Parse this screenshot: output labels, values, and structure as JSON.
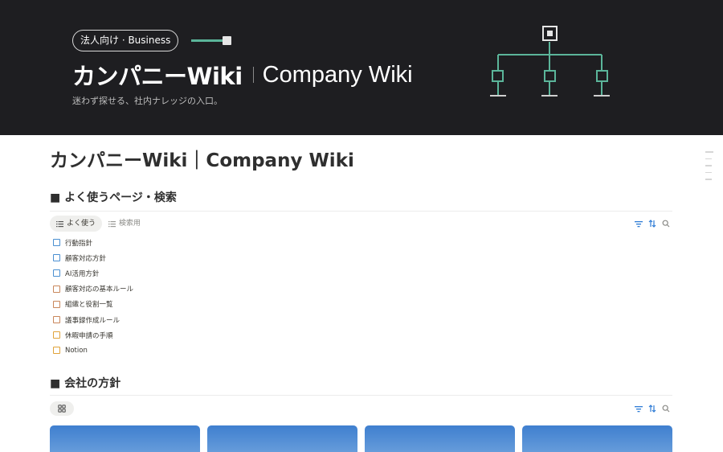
{
  "banner": {
    "badge": "法人向け · Business",
    "title_jp": "カンパニーWiki",
    "title_en": "Company Wiki",
    "subtitle": "迷わず探せる、社内ナレッジの入口。",
    "diagram_icon": "org-chart-icon"
  },
  "page": {
    "title": "カンパニーWiki｜Company Wiki"
  },
  "sections": {
    "frequent": {
      "heading": "■ よく使うページ・検索",
      "tabs": [
        {
          "label": "よく使う",
          "icon": "list-icon",
          "active": true
        },
        {
          "label": "検索用",
          "icon": "list-icon",
          "active": false
        }
      ],
      "items": [
        {
          "label": "行動指針",
          "color": "#4a8fd1"
        },
        {
          "label": "顧客対応方針",
          "color": "#4a8fd1"
        },
        {
          "label": "AI活用方針",
          "color": "#4a8fd1"
        },
        {
          "label": "顧客対応の基本ルール",
          "color": "#c9875b"
        },
        {
          "label": "組織と役割一覧",
          "color": "#c9875b"
        },
        {
          "label": "議事録作成ルール",
          "color": "#c9875b"
        },
        {
          "label": "休暇申請の手順",
          "color": "#e0a33a"
        },
        {
          "label": "Notion",
          "color": "#e0a33a"
        }
      ]
    },
    "policy": {
      "heading": "■ 会社の方針",
      "view_icon": "gallery-icon",
      "cards": 4
    }
  },
  "toolbar_icons": [
    "filter-icon",
    "sort-icon",
    "search-icon"
  ],
  "colors": {
    "banner_bg": "#1e1e21",
    "accent_green": "#5bb59a",
    "toolbar_blue": "#2e7cd6",
    "card_blue": "#3f7fcf"
  }
}
